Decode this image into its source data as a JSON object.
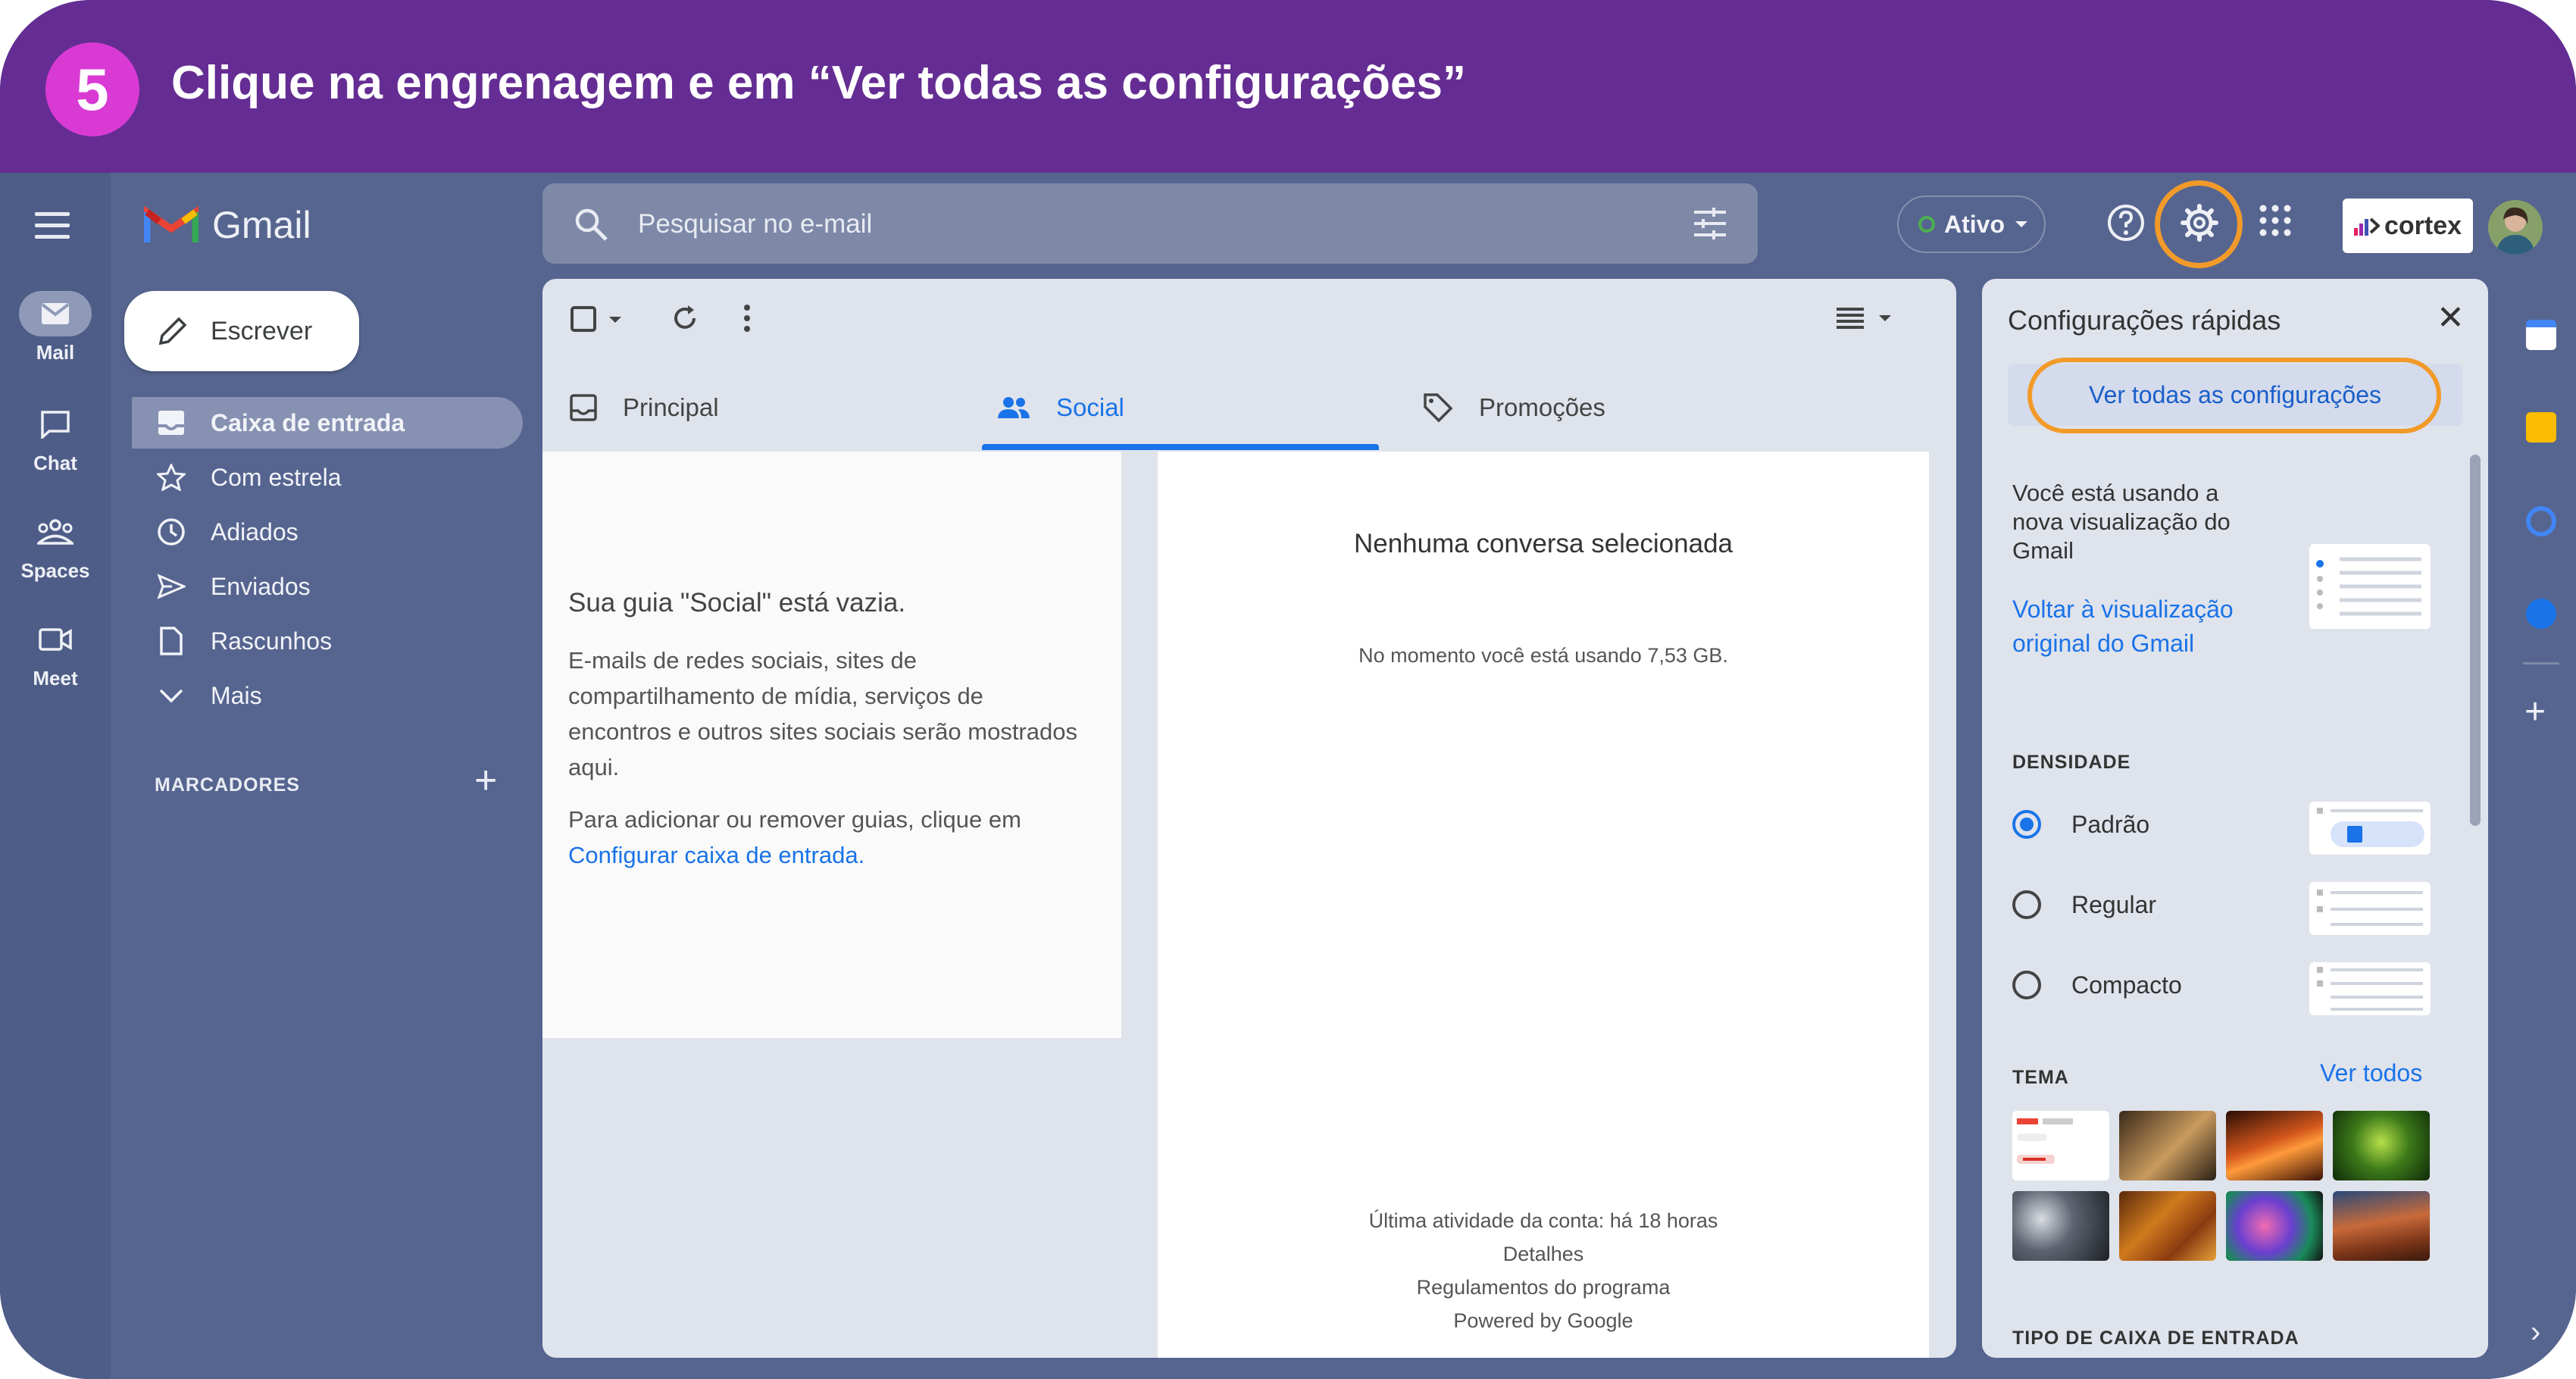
{
  "banner": {
    "step": "5",
    "title": "Clique na engrenagem e em “Ver todas as configurações”"
  },
  "app": {
    "name": "Gmail"
  },
  "rail": {
    "items": [
      {
        "label": "Mail",
        "icon": "mail-icon"
      },
      {
        "label": "Chat",
        "icon": "chat-icon"
      },
      {
        "label": "Spaces",
        "icon": "spaces-icon"
      },
      {
        "label": "Meet",
        "icon": "meet-icon"
      }
    ]
  },
  "compose": {
    "label": "Escrever"
  },
  "nav": {
    "items": [
      {
        "label": "Caixa de entrada",
        "icon": "inbox-icon"
      },
      {
        "label": "Com estrela",
        "icon": "star-icon"
      },
      {
        "label": "Adiados",
        "icon": "clock-icon"
      },
      {
        "label": "Enviados",
        "icon": "send-icon"
      },
      {
        "label": "Rascunhos",
        "icon": "draft-icon"
      },
      {
        "label": "Mais",
        "icon": "chevron-down-icon"
      }
    ],
    "labels_heading": "MARCADORES"
  },
  "search": {
    "placeholder": "Pesquisar no e-mail"
  },
  "status": {
    "label": "Ativo",
    "color": "#4caf50"
  },
  "brand": {
    "logo_text": "cortex"
  },
  "tabs": [
    {
      "label": "Principal",
      "icon": "inbox-tab-icon"
    },
    {
      "label": "Social",
      "icon": "people-icon"
    },
    {
      "label": "Promoções",
      "icon": "tag-icon"
    }
  ],
  "empty": {
    "title": "Sua guia \"Social\" está vazia.",
    "body": "E-mails de redes sociais, sites de compartilhamento de mídia, serviços de encontros e outros sites sociais serão mostrados aqui.",
    "hint": "Para adicionar ou remover guias, clique em",
    "link": "Configurar caixa de entrada."
  },
  "reading": {
    "no_conversation": "Nenhuma conversa selecionada",
    "storage": "No momento você está usando 7,53 GB.",
    "footer": [
      "Última atividade da conta: há 18 horas",
      "Detalhes",
      "Regulamentos do programa",
      "Powered by Google"
    ]
  },
  "quick_settings": {
    "title": "Configurações rápidas",
    "all_settings": "Ver todas as configurações",
    "view_text": "Você está usando a nova visualização do Gmail",
    "view_link": "Voltar à visualização original do Gmail",
    "density_heading": "DENSIDADE",
    "density_options": [
      {
        "label": "Padrão",
        "selected": true
      },
      {
        "label": "Regular",
        "selected": false
      },
      {
        "label": "Compacto",
        "selected": false
      }
    ],
    "theme_heading": "TEMA",
    "theme_all": "Ver todos",
    "themes": [
      "default",
      "chess",
      "canyon",
      "leaf",
      "bubbles",
      "autumn",
      "lights",
      "desert"
    ],
    "inbox_type_heading": "TIPO DE CAIXA DE ENTRADA"
  },
  "colors": {
    "banner": "#652d93",
    "step_badge": "#d93ad4",
    "highlight": "#f29a29",
    "link": "#1a73e8"
  }
}
